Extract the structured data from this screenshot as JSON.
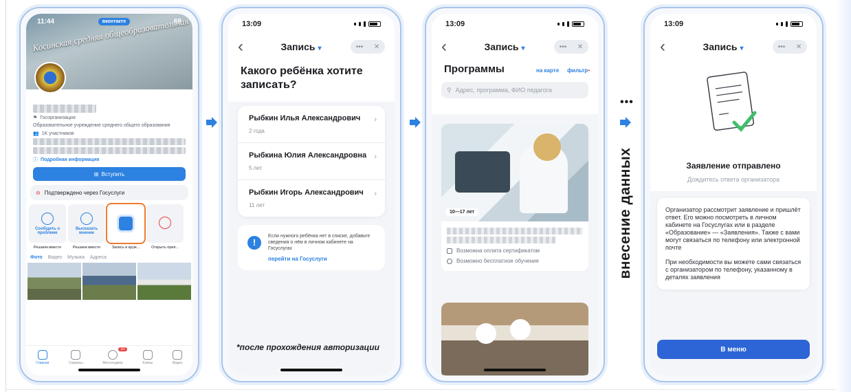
{
  "phone1": {
    "status": {
      "time": "11:44",
      "app_pill": "вконтакте",
      "battery": "68"
    },
    "banner": "Косинская средняя общеобразовательная школа",
    "type_label": "Госорганизация",
    "description": "Образовательное учреждение среднего общего образования",
    "members": "1K участников",
    "more_info": "Подробная информация",
    "join": "Вступить",
    "verified": "Подтверждено через Госуслуги",
    "apps": [
      {
        "title": "Сообщить о проблеме",
        "caption": "Решаем вместе"
      },
      {
        "title": "Высказать мнение",
        "caption": "Решаем вместе"
      },
      {
        "title": "",
        "caption": "Запись в круж..."
      },
      {
        "title": "",
        "caption": "Открыть прия..."
      }
    ],
    "tabs": [
      "Фото",
      "Видео",
      "Музыка",
      "Адреса"
    ],
    "tabbar": [
      {
        "label": "Главная"
      },
      {
        "label": "Сервисы"
      },
      {
        "label": "Мессенджер",
        "badge": "10"
      },
      {
        "label": "Клипы"
      },
      {
        "label": "Видео"
      }
    ]
  },
  "phone2": {
    "status": {
      "time": "13:09"
    },
    "nav_title": "Запись",
    "question": "Какого ребёнка хотите записать?",
    "children": [
      {
        "name": "Рыбкин Илья Александрович",
        "age": "2 года"
      },
      {
        "name": "Рыбкина Юлия Александровна",
        "age": "5 лет"
      },
      {
        "name": "Рыбкин Игорь Александрович",
        "age": "11 лет"
      }
    ],
    "notice": "Если нужного ребёнка нет в списке, добавьте сведения о нём в личном кабинете на Госуслугах",
    "notice_link": "перейти на Госуслуги",
    "footnote": "*после прохождения авторизации"
  },
  "phone3": {
    "status": {
      "time": "13:09"
    },
    "nav_title": "Запись",
    "heading": "Программы",
    "on_map": "на карте",
    "filter": "фильтр",
    "search_placeholder": "Адрес, программа, ФИО педагога",
    "age_chip": "10—17 лет",
    "features": [
      "Возможна оплата сертификатом",
      "Возможно бесплатное обучение"
    ]
  },
  "phone4": {
    "status": {
      "time": "13:09"
    },
    "nav_title": "Запись",
    "sent_title": "Заявление отправлено",
    "sent_sub": "Дождитесь ответа организатора",
    "para1": "Организатор рассмотрит заявление и пришлёт ответ. Его можно посмотреть в личном кабинете на Госуслугах или в разделе «Образование» — «Заявления». Также с вами могут связаться по телефону или электронной почте",
    "para2": "При необходимости вы можете сами связаться с организатором по телефону, указанному в деталях заявления",
    "button": "В меню"
  },
  "between": {
    "dots": "•••",
    "vertical_label": "внесение данных"
  },
  "colors": {
    "accent": "#2d81e0",
    "highlight": "#f07a2e",
    "frame": "#a9c5ea"
  }
}
